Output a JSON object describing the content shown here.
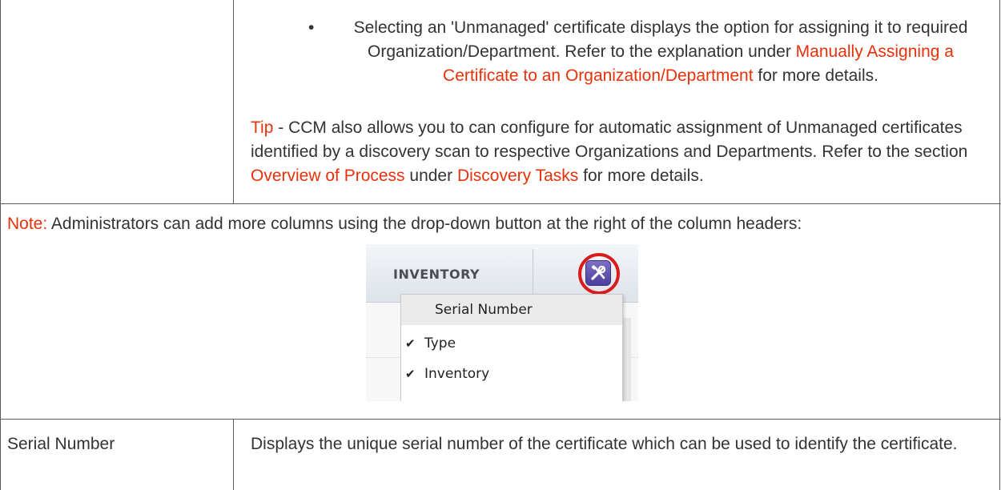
{
  "row1": {
    "bullet_symbol": "•",
    "bullet_text_before": "Selecting an 'Unmanaged' certificate displays the option for assigning it to required Organization/Department. Refer to the explanation under ",
    "bullet_link": "Manually Assigning a Certificate to an Organization/Department",
    "bullet_text_after": " for more details.",
    "tip_label": "Tip",
    "tip_text": " - CCM also allows you to can configure for automatic assignment of Unmanaged certificates identified by a discovery scan to respective Organizations and Departments. Refer to the section ",
    "tip_link1": "Overview of Process",
    "tip_mid": " under ",
    "tip_link2": "Discovery Tasks",
    "tip_after": " for more details."
  },
  "note": {
    "label": "Note:",
    "text": " Administrators can add more columns using the drop-down button at the right of the column headers:"
  },
  "screenshot": {
    "column_header": "INVENTORY",
    "settings_icon": "wrench-icon",
    "menu_items": [
      {
        "label": "Serial Number",
        "checked": false
      },
      {
        "label": "Type",
        "checked": true
      },
      {
        "label": "Inventory",
        "checked": true
      }
    ],
    "check_symbol": "✔"
  },
  "row_serial": {
    "label": "Serial Number",
    "description": "Displays the unique serial number of the certificate which can be used to identify the certificate."
  },
  "colors": {
    "link": "#e8310a",
    "text": "#333333",
    "border": "#5a5a5a",
    "highlight_ring": "#d81c1c"
  }
}
